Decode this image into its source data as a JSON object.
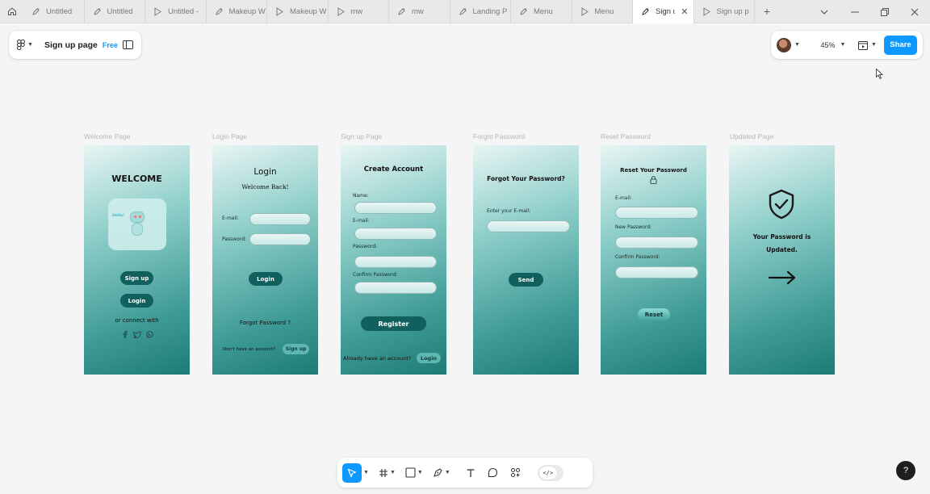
{
  "tabs": [
    {
      "label": "Untitled",
      "icon": "figjam-icon",
      "active": false
    },
    {
      "label": "Untitled",
      "icon": "figjam-icon",
      "active": false
    },
    {
      "label": "Untitled -",
      "icon": "play-icon",
      "active": false
    },
    {
      "label": "Makeup W",
      "icon": "figjam-icon",
      "active": false
    },
    {
      "label": "Makeup W",
      "icon": "play-icon",
      "active": false
    },
    {
      "label": "mw",
      "icon": "play-icon",
      "active": false
    },
    {
      "label": "mw",
      "icon": "figjam-icon",
      "active": false
    },
    {
      "label": "Landing P",
      "icon": "figjam-icon",
      "active": false
    },
    {
      "label": "Menu",
      "icon": "figjam-icon",
      "active": false
    },
    {
      "label": "Menu",
      "icon": "play-icon",
      "active": false
    },
    {
      "label": "Sign u",
      "icon": "figjam-icon",
      "active": true
    },
    {
      "label": "Sign up p",
      "icon": "play-icon",
      "active": false
    }
  ],
  "file": {
    "name": "Sign up page",
    "plan": "Free"
  },
  "header": {
    "zoom": "45%",
    "share_label": "Share"
  },
  "frames": {
    "welcome": {
      "label": "Welcome Page",
      "title": "WELCOME",
      "robot_text": "Hello!",
      "signup": "Sign up",
      "login": "Login",
      "connect": "or connect with"
    },
    "login": {
      "label": "Login Page",
      "title": "Login",
      "subtitle": "Welcome Back!",
      "email": "E-mail:",
      "password": "Password:",
      "button": "Login",
      "forgot": "Forgot Password ?",
      "noaccount": "Don't have an account?",
      "signup": "Sign up"
    },
    "signup": {
      "label": "Sign up Page",
      "title": "Create Account",
      "name": "Name:",
      "email": "E-mail:",
      "password": "Password:",
      "confirm": "Confirm Password:",
      "button": "Register",
      "have_account": "Already have an account?",
      "login": "Login"
    },
    "forgot": {
      "label": "Forgot Password",
      "title": "Forgot Your Password?",
      "email": "Enter your E-mail:",
      "button": "Send"
    },
    "reset": {
      "label": "Reset Password",
      "title": "Reset Your Password",
      "email": "E-mail:",
      "new_password": "New Password:",
      "confirm": "Confirm Password:",
      "button": "Reset"
    },
    "updated": {
      "label": "Updated Page",
      "line1": "Your Password is",
      "line2": "Updated."
    }
  },
  "toolbar": {
    "tools": [
      "move-tool",
      "frame-tool",
      "shape-tool",
      "pen-tool",
      "text-tool",
      "comment-tool",
      "actions-tool"
    ],
    "dev_mode": "</>"
  },
  "help": "?",
  "colors": {
    "accent": "#0d99ff",
    "button": "#11605d"
  }
}
